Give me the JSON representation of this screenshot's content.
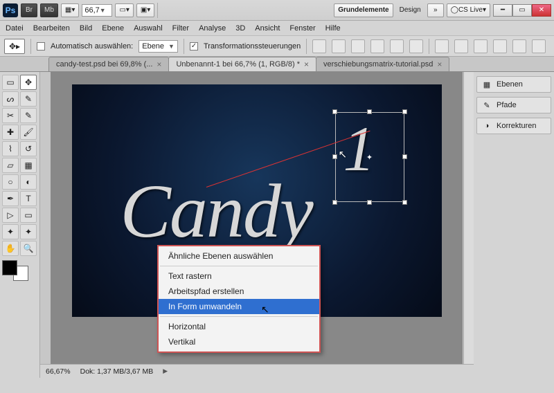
{
  "titlebar": {
    "app": "Ps",
    "br": "Br",
    "mb": "Mb",
    "zoom": "66,7",
    "workspace_active": "Grundelemente",
    "workspace2": "Design",
    "cslive": "CS Live"
  },
  "menu": [
    "Datei",
    "Bearbeiten",
    "Bild",
    "Ebene",
    "Auswahl",
    "Filter",
    "Analyse",
    "3D",
    "Ansicht",
    "Fenster",
    "Hilfe"
  ],
  "options": {
    "auto_label": "Automatisch auswählen:",
    "auto_value": "Ebene",
    "transform_label": "Transformationssteuerungen"
  },
  "tabs": [
    {
      "label": "candy-test.psd bei 69,8% (...",
      "active": false
    },
    {
      "label": "Unbenannt-1 bei 66,7% (1, RGB/8) *",
      "active": true
    },
    {
      "label": "verschiebungsmatrix-tutorial.psd",
      "active": false
    }
  ],
  "canvas": {
    "text_main": "Candy",
    "text_sel": "1"
  },
  "context_menu": {
    "items": [
      "Ähnliche Ebenen auswählen",
      "",
      "Text rastern",
      "Arbeitspfad erstellen",
      "In Form umwandeln",
      "",
      "Horizontal",
      "Vertikal"
    ],
    "highlight_index": 4
  },
  "dock": {
    "items": [
      "Ebenen",
      "Pfade",
      "Korrekturen"
    ]
  },
  "status": {
    "zoom": "66,67%",
    "doc": "Dok: 1,37 MB/3,67 MB"
  }
}
